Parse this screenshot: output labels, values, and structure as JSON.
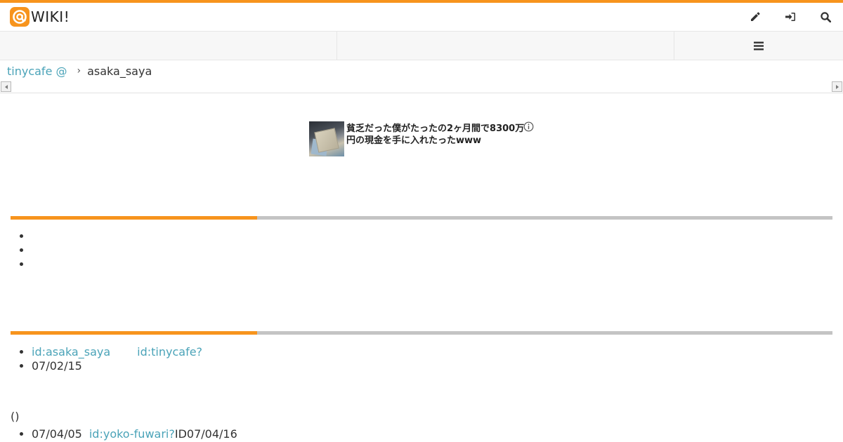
{
  "header": {
    "logo_text": "WIKI!",
    "icons": [
      "edit-pencil-icon",
      "sign-in-icon",
      "search-icon"
    ]
  },
  "navbar": {
    "menu_icon": "hamburger-menu-icon"
  },
  "breadcrumb": {
    "wiki_link": "tinycafe @",
    "separator": "›",
    "current": "asaka_saya"
  },
  "ad": {
    "text": "貧乏だった僕がたったの2ヶ月間で8300万円の現金を手に入れたったwww",
    "info_icon": "info-icon"
  },
  "meta": {
    "id_self": "id:asaka_saya",
    "id_link": "id:tinycafe?",
    "date": "07/02/15"
  },
  "paren_text": "()",
  "history": {
    "date": "07/04/05",
    "id_link": "id:yoko-fuwari?",
    "suffix": "ID07/04/16"
  },
  "colors": {
    "accent": "#f7941d",
    "link": "#4aa3b8",
    "divider": "#c4c4c4"
  }
}
